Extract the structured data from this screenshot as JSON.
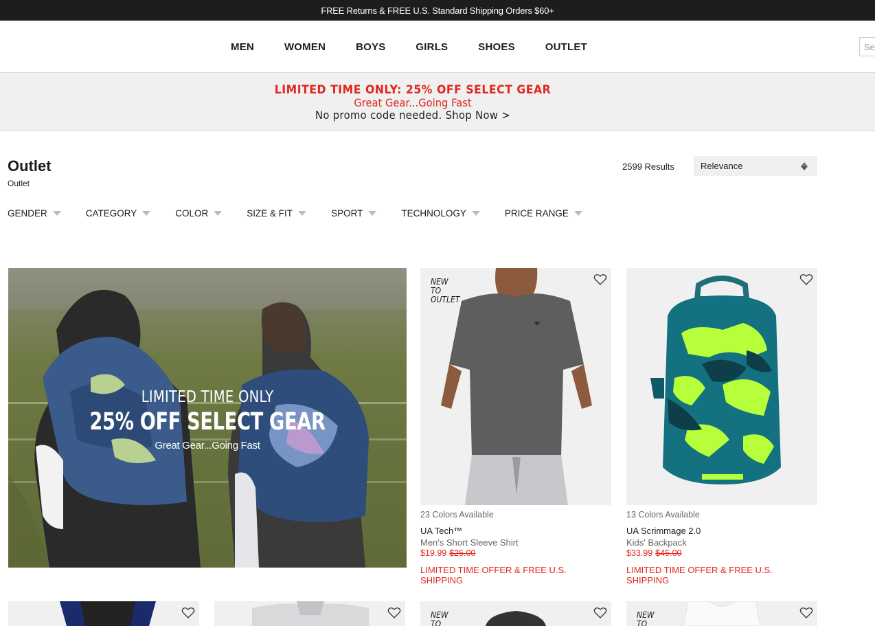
{
  "topbar": {
    "text": "FREE Returns & FREE U.S. Standard Shipping Orders $60+"
  },
  "nav": {
    "items": [
      "MEN",
      "WOMEN",
      "BOYS",
      "GIRLS",
      "SHOES",
      "OUTLET"
    ]
  },
  "search": {
    "placeholder": "Search"
  },
  "promo": {
    "line1": "LIMITED TIME ONLY: 25% OFF SELECT GEAR",
    "line2": "Great Gear...Going Fast",
    "line3": "No promo code needed. Shop Now >"
  },
  "page": {
    "title": "Outlet",
    "breadcrumb": "Outlet",
    "results": "2599 Results",
    "sort": "Relevance"
  },
  "filters": [
    "GENDER",
    "CATEGORY",
    "COLOR",
    "SIZE & FIT",
    "SPORT",
    "TECHNOLOGY",
    "PRICE RANGE"
  ],
  "hero": {
    "line1": "LIMITED TIME ONLY",
    "line2": "25% OFF SELECT GEAR",
    "line3": "Great Gear...Going Fast"
  },
  "products": [
    {
      "tag": [
        "NEW",
        "TO",
        "OUTLET"
      ],
      "colors": "23 Colors Available",
      "name": "UA Tech™",
      "sub": "Men's Short Sleeve Shirt",
      "price": "$19.99",
      "old_price": "$25.00",
      "offer": "LIMITED TIME OFFER & FREE U.S. SHIPPING"
    },
    {
      "colors": "13 Colors Available",
      "name": "UA Scrimmage 2.0",
      "sub": "Kids' Backpack",
      "price": "$33.99",
      "old_price": "$45.00",
      "offer": "LIMITED TIME OFFER & FREE U.S. SHIPPING"
    }
  ],
  "row2": {
    "tags": [
      "NEW",
      "TO"
    ]
  },
  "colors": {
    "accent_red": "#e1261c",
    "dark": "#1d1d1d",
    "panel": "#f0f0f0"
  }
}
